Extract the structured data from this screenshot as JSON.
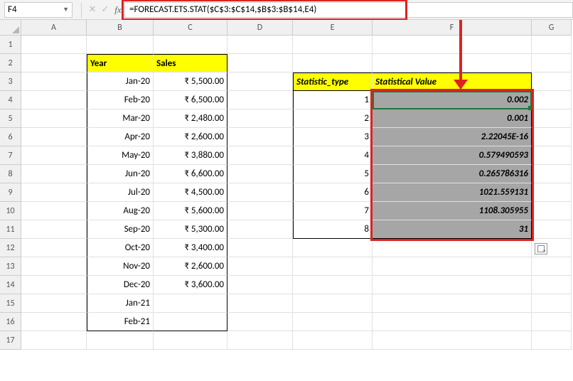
{
  "namebox": {
    "value": "F4"
  },
  "formula_bar": {
    "value": "=FORECAST.ETS.STAT($C$3:$C$14,$B$3:$B$14,E4)"
  },
  "columns": [
    "A",
    "B",
    "C",
    "D",
    "E",
    "F",
    "G"
  ],
  "row_count": 17,
  "table": {
    "headers": {
      "year": "Year",
      "sales": "Sales"
    },
    "rows": [
      {
        "year": "Jan-20",
        "sales": "₹ 5,500.00"
      },
      {
        "year": "Feb-20",
        "sales": "₹ 6,500.00"
      },
      {
        "year": "Mar-20",
        "sales": "₹ 2,480.00"
      },
      {
        "year": "Apr-20",
        "sales": "₹ 2,600.00"
      },
      {
        "year": "May-20",
        "sales": "₹ 3,880.00"
      },
      {
        "year": "Jun-20",
        "sales": "₹ 6,600.00"
      },
      {
        "year": "Jul-20",
        "sales": "₹ 4,500.00"
      },
      {
        "year": "Aug-20",
        "sales": "₹ 5,600.00"
      },
      {
        "year": "Sep-20",
        "sales": "₹ 5,300.00"
      },
      {
        "year": "Oct-20",
        "sales": "₹ 3,400.00"
      },
      {
        "year": "Nov-20",
        "sales": "₹ 2,600.00"
      },
      {
        "year": "Dec-20",
        "sales": "₹ 3,600.00"
      },
      {
        "year": "Jan-21",
        "sales": ""
      },
      {
        "year": "Feb-21",
        "sales": ""
      }
    ]
  },
  "stats": {
    "headers": {
      "type": "Statistic_type",
      "value": "Statistical Value"
    },
    "rows": [
      {
        "type": "1",
        "value": "0.002"
      },
      {
        "type": "2",
        "value": "0.001"
      },
      {
        "type": "3",
        "value": "2.22045E-16"
      },
      {
        "type": "4",
        "value": "0.579490593"
      },
      {
        "type": "5",
        "value": "0.265786316"
      },
      {
        "type": "6",
        "value": "1021.559131"
      },
      {
        "type": "7",
        "value": "1108.305955"
      },
      {
        "type": "8",
        "value": "31"
      }
    ]
  },
  "icons": {
    "cancel": "✕",
    "enter": "✓",
    "fx": "fx",
    "dropdown": "▼"
  },
  "chart_data": {
    "type": "table",
    "title": "FORECAST.ETS.STAT results",
    "categories": [
      1,
      2,
      3,
      4,
      5,
      6,
      7,
      8
    ],
    "values": [
      0.002,
      0.001,
      2.22045e-16,
      0.579490593,
      0.265786316,
      1021.559131,
      1108.305955,
      31
    ],
    "xlabel": "Statistic_type",
    "ylabel": "Statistical Value"
  }
}
